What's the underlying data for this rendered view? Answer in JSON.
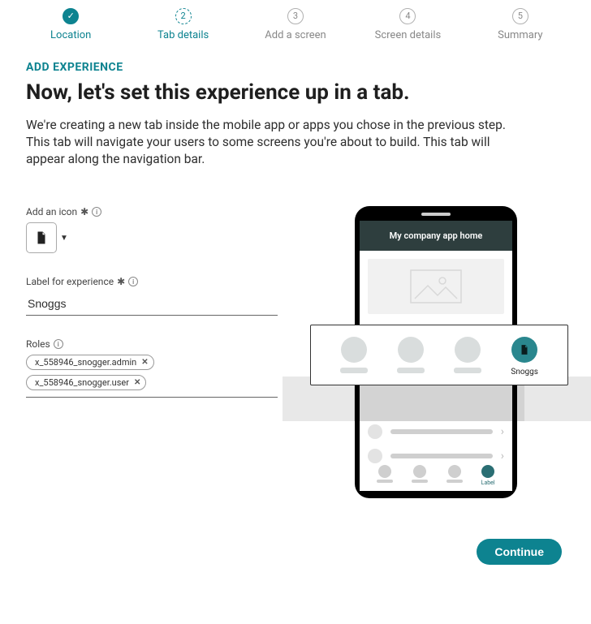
{
  "stepper": {
    "steps": [
      {
        "num": "1",
        "label": "Location",
        "state": "completed"
      },
      {
        "num": "2",
        "label": "Tab details",
        "state": "current"
      },
      {
        "num": "3",
        "label": "Add a screen",
        "state": "upcoming"
      },
      {
        "num": "4",
        "label": "Screen details",
        "state": "upcoming"
      },
      {
        "num": "5",
        "label": "Summary",
        "state": "upcoming"
      }
    ]
  },
  "header": {
    "overline": "ADD EXPERIENCE",
    "title": "Now, let's set this experience up in a tab.",
    "description": "We're creating a new tab inside the mobile app or apps you chose in the previous step. This tab will navigate your users to some screens you're about to build. This tab will appear along the navigation bar."
  },
  "form": {
    "icon_field_label": "Add an icon",
    "selected_icon": "document-icon",
    "label_field_label": "Label for experience",
    "label_value": "Snoggs",
    "roles_label": "Roles",
    "roles": [
      "x_558946_snogger.admin",
      "x_558946_snogger.user"
    ]
  },
  "preview": {
    "phone_title": "My company app home",
    "nav_active_label": "Label",
    "float_active_label": "Snoggs"
  },
  "footer": {
    "continue_label": "Continue"
  }
}
